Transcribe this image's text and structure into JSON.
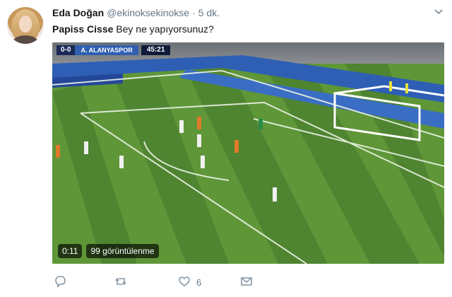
{
  "tweet": {
    "author_name": "Eda Doğan",
    "author_handle": "@ekinoksekinokse",
    "separator": "·",
    "timestamp": "5 dk.",
    "mention": "Papiss Cisse",
    "text": "Bey ne yapıyorsunuz?"
  },
  "video": {
    "scoreboard": {
      "score": "0-0",
      "team": "A. ALANYASPOR",
      "clock": "45:21"
    },
    "duration": "0:11",
    "views": "99 görüntülenme"
  },
  "actions": {
    "reply_icon": "reply-icon",
    "retweet_icon": "retweet-icon",
    "like_icon": "heart-icon",
    "like_count": "6",
    "dm_icon": "envelope-icon"
  },
  "colors": {
    "text": "#14171a",
    "secondary": "#657786",
    "pitch_dark": "#4f8430",
    "pitch_light": "#66a03e"
  }
}
